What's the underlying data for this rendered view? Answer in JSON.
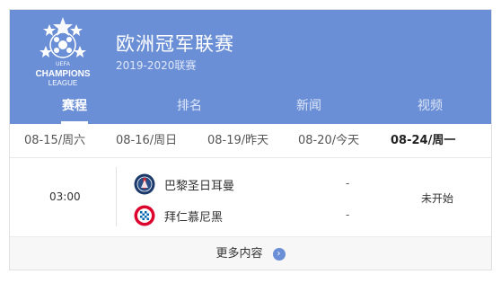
{
  "league": {
    "logo_text_1": "CHAMPIONS",
    "logo_text_2": "LEAGUE",
    "logo_text_uefa": "UEFA",
    "title": "欧洲冠军联赛",
    "season": "2019-2020联赛"
  },
  "tabs": [
    {
      "label": "赛程",
      "active": true
    },
    {
      "label": "排名",
      "active": false
    },
    {
      "label": "新闻",
      "active": false
    },
    {
      "label": "视频",
      "active": false
    }
  ],
  "dates": [
    {
      "label": "08-15/周六",
      "active": false
    },
    {
      "label": "08-16/周日",
      "active": false
    },
    {
      "label": "08-19/昨天",
      "active": false
    },
    {
      "label": "08-20/今天",
      "active": false
    },
    {
      "label": "08-24/周一",
      "active": true
    }
  ],
  "match": {
    "time": "03:00",
    "status": "未开始",
    "home": {
      "name": "巴黎圣日耳曼",
      "score": "-",
      "logo_icon": "psg-crest-icon",
      "color": "#1b3a6b"
    },
    "away": {
      "name": "拜仁慕尼黑",
      "score": "-",
      "logo_icon": "bayern-crest-icon",
      "color": "#dc052d"
    }
  },
  "more": {
    "label": "更多内容",
    "icon": "chevron-right-circle-icon"
  },
  "colors": {
    "header_bg": "#6b8fd6",
    "accent": "#6b8fd6"
  }
}
